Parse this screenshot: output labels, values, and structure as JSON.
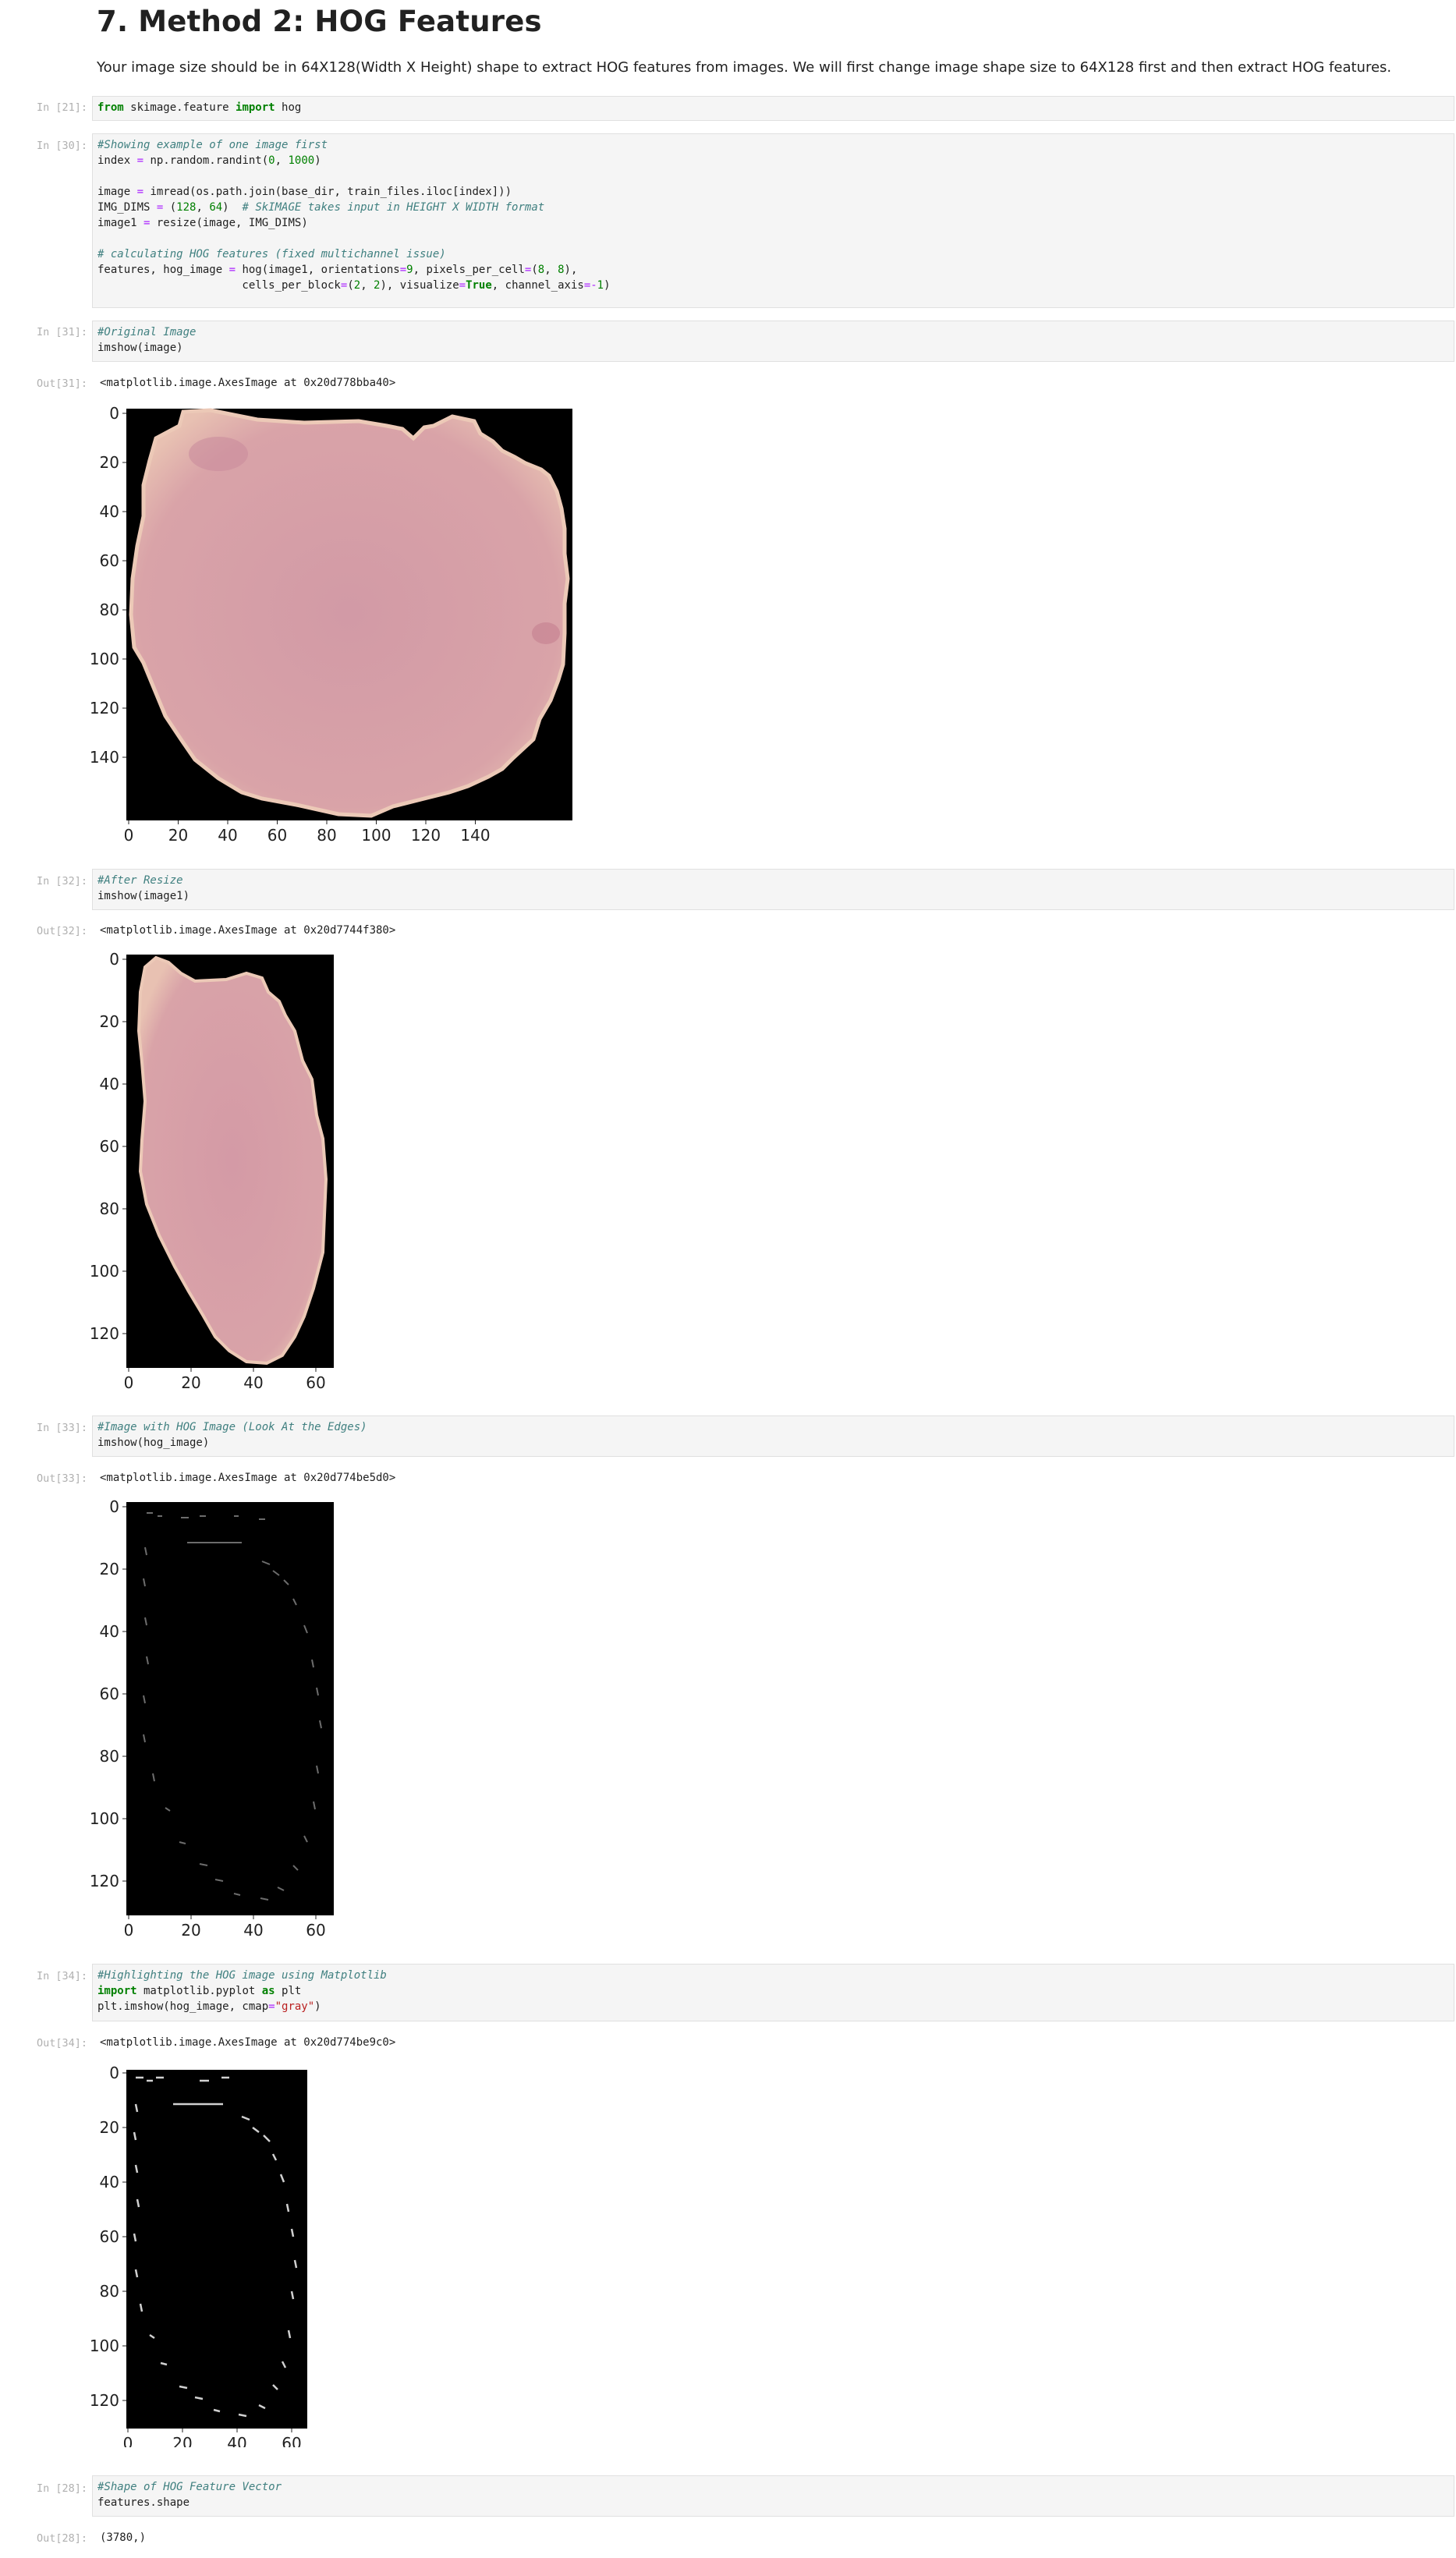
{
  "section": {
    "heading": "7. Method 2: HOG Features",
    "description": "Your image size should be in 64X128(Width X Height) shape to extract HOG features from images. We will first change image shape size to 64X128 first and then extract HOG features."
  },
  "cells": {
    "c1": {
      "prompt": "In [21]:",
      "lines": [
        [
          [
            "kw",
            "from"
          ],
          [
            "t",
            " skimage.feature "
          ],
          [
            "kw",
            "import"
          ],
          [
            "t",
            " hog"
          ]
        ]
      ]
    },
    "c2": {
      "prompt": "In [30]:",
      "lines": [
        [
          [
            "cm",
            "#Showing example of one image first"
          ]
        ],
        [
          [
            "t",
            "index "
          ],
          [
            "op",
            "="
          ],
          [
            "t",
            " np.random.randint("
          ],
          [
            "num",
            "0"
          ],
          [
            "t",
            ", "
          ],
          [
            "num",
            "1000"
          ],
          [
            "t",
            ")"
          ]
        ],
        [
          [
            "t",
            ""
          ]
        ],
        [
          [
            "t",
            "image "
          ],
          [
            "op",
            "="
          ],
          [
            "t",
            " imread(os.path.join(base_dir, train_files.iloc[index]))"
          ]
        ],
        [
          [
            "t",
            "IMG_DIMS "
          ],
          [
            "op",
            "="
          ],
          [
            "t",
            " ("
          ],
          [
            "num",
            "128"
          ],
          [
            "t",
            ", "
          ],
          [
            "num",
            "64"
          ],
          [
            "t",
            ")  "
          ],
          [
            "cm",
            "# SkIMAGE takes input in HEIGHT X WIDTH format"
          ]
        ],
        [
          [
            "t",
            "image1 "
          ],
          [
            "op",
            "="
          ],
          [
            "t",
            " resize(image, IMG_DIMS)"
          ]
        ],
        [
          [
            "t",
            ""
          ]
        ],
        [
          [
            "cm",
            "# calculating HOG features (fixed multichannel issue)"
          ]
        ],
        [
          [
            "t",
            "features, hog_image "
          ],
          [
            "op",
            "="
          ],
          [
            "t",
            " hog(image1, orientations"
          ],
          [
            "op",
            "="
          ],
          [
            "num",
            "9"
          ],
          [
            "t",
            ", pixels_per_cell"
          ],
          [
            "op",
            "="
          ],
          [
            "t",
            "("
          ],
          [
            "num",
            "8"
          ],
          [
            "t",
            ", "
          ],
          [
            "num",
            "8"
          ],
          [
            "t",
            "),"
          ]
        ],
        [
          [
            "t",
            "                      cells_per_block"
          ],
          [
            "op",
            "="
          ],
          [
            "t",
            "("
          ],
          [
            "num",
            "2"
          ],
          [
            "t",
            ", "
          ],
          [
            "num",
            "2"
          ],
          [
            "t",
            "), visualize"
          ],
          [
            "op",
            "="
          ],
          [
            "kw",
            "True"
          ],
          [
            "t",
            ", channel_axis"
          ],
          [
            "op",
            "=-"
          ],
          [
            "num",
            "1"
          ],
          [
            "t",
            ")"
          ]
        ]
      ]
    },
    "c3": {
      "prompt": "In [31]:",
      "lines": [
        [
          [
            "cm",
            "#Original Image"
          ]
        ],
        [
          [
            "t",
            "imshow(image)"
          ]
        ]
      ]
    },
    "c4": {
      "prompt": "In [32]:",
      "lines": [
        [
          [
            "cm",
            "#After Resize"
          ]
        ],
        [
          [
            "t",
            "imshow(image1)"
          ]
        ]
      ]
    },
    "c5": {
      "prompt": "In [33]:",
      "lines": [
        [
          [
            "cm",
            "#Image with HOG Image (Look At the Edges)"
          ]
        ],
        [
          [
            "t",
            "imshow(hog_image)"
          ]
        ]
      ]
    },
    "c6": {
      "prompt": "In [34]:",
      "lines": [
        [
          [
            "cm",
            "#Highlighting the HOG image using Matplotlib"
          ]
        ],
        [
          [
            "kw",
            "import"
          ],
          [
            "t",
            " matplotlib.pyplot "
          ],
          [
            "kw",
            "as"
          ],
          [
            "t",
            " plt"
          ]
        ],
        [
          [
            "t",
            "plt.imshow(hog_image, cmap"
          ],
          [
            "op",
            "="
          ],
          [
            "str",
            "\"gray\""
          ],
          [
            "t",
            ")"
          ]
        ]
      ]
    },
    "c7": {
      "prompt": "In [28]:",
      "lines": [
        [
          [
            "cm",
            "#Shape of HOG Feature Vector"
          ]
        ],
        [
          [
            "t",
            "features.shape"
          ]
        ]
      ]
    }
  },
  "outputs": {
    "o1": {
      "prompt": "Out[31]:",
      "text": "<matplotlib.image.AxesImage at 0x20d778bba40>"
    },
    "o2": {
      "prompt": "Out[32]:",
      "text": "<matplotlib.image.AxesImage at 0x20d7744f380>"
    },
    "o3": {
      "prompt": "Out[33]:",
      "text": "<matplotlib.image.AxesImage at 0x20d774be5d0>"
    },
    "o4": {
      "prompt": "Out[34]:",
      "text": "<matplotlib.image.AxesImage at 0x20d774be9c0>"
    },
    "o5": {
      "prompt": "Out[28]:",
      "text": "(3780,)"
    }
  },
  "plots": {
    "p1": {
      "xticks": [
        "0",
        "20",
        "40",
        "60",
        "80",
        "100",
        "120",
        "140"
      ],
      "yticks": [
        "0",
        "20",
        "40",
        "60",
        "80",
        "100",
        "120",
        "140"
      ],
      "image": "cell-rgb"
    },
    "p2": {
      "xticks": [
        "0",
        "20",
        "40",
        "60"
      ],
      "yticks": [
        "0",
        "20",
        "40",
        "60",
        "80",
        "100",
        "120"
      ],
      "image": "cell-rgb-resized"
    },
    "p3": {
      "xticks": [
        "0",
        "20",
        "40",
        "60"
      ],
      "yticks": [
        "0",
        "20",
        "40",
        "60",
        "80",
        "100",
        "120"
      ],
      "image": "hog-image"
    },
    "p4": {
      "xticks": [
        "0",
        "20",
        "40",
        "60"
      ],
      "yticks": [
        "0",
        "20",
        "40",
        "60",
        "80",
        "100",
        "120"
      ],
      "image": "hog-image-gray"
    }
  },
  "colors": {
    "cell_pink": "#d69aa4",
    "cell_edge": "#e9c4b8",
    "background": "#000000",
    "keyword": "#008000",
    "comment": "#408080",
    "string": "#ba2121"
  }
}
